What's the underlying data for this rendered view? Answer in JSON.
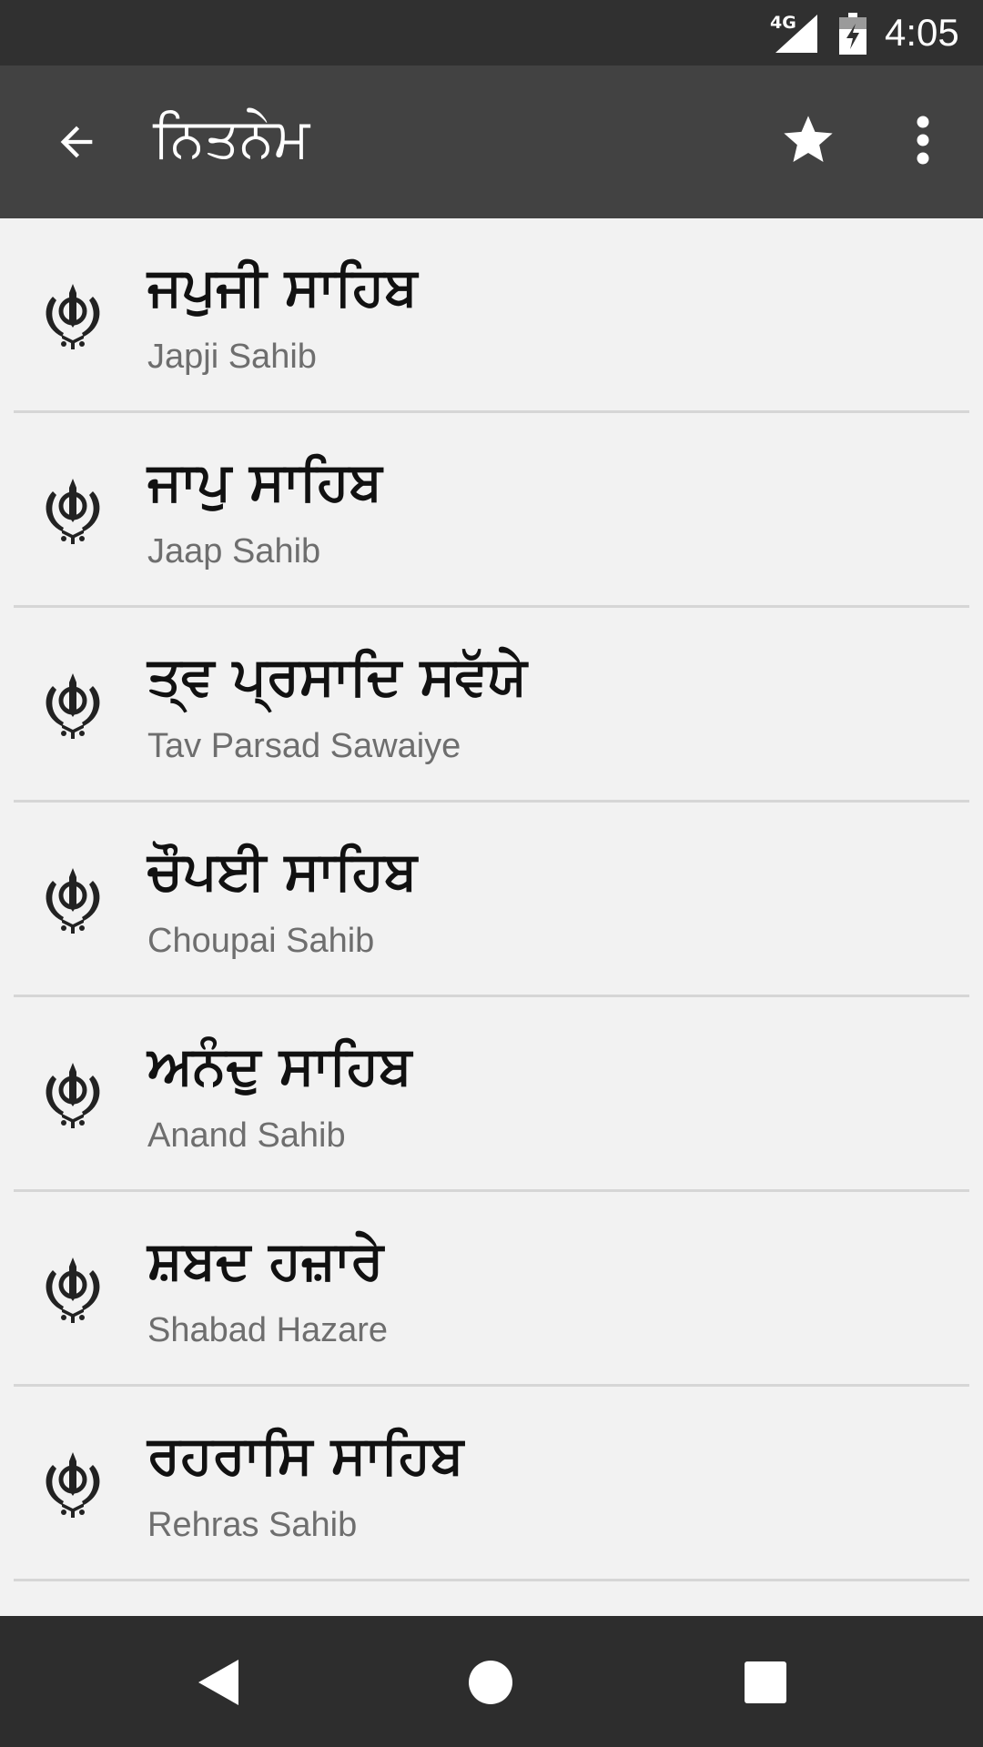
{
  "status_bar": {
    "network": "4G",
    "time": "4:05",
    "icons": [
      "signal-icon",
      "battery-charging-icon"
    ]
  },
  "app_bar": {
    "title": "ਨਿਤਨੇਮ",
    "icons": [
      "arrow-back-icon",
      "star-icon",
      "more-vert-icon"
    ]
  },
  "list": {
    "item_icon": "khanda-icon",
    "items": [
      {
        "title": "ਜਪੁਜੀ ਸਾਹਿਬ",
        "subtitle": "Japji Sahib"
      },
      {
        "title": "ਜਾਪੁ ਸਾਹਿਬ",
        "subtitle": "Jaap Sahib"
      },
      {
        "title": "ਤ੍ਵ ਪ੍ਰਸਾਦਿ ਸਵੱਯੇ",
        "subtitle": "Tav Parsad Sawaiye"
      },
      {
        "title": "ਚੌਪਈ ਸਾਹਿਬ",
        "subtitle": "Choupai Sahib"
      },
      {
        "title": "ਅਨੰਦੁ ਸਾਹਿਬ",
        "subtitle": "Anand Sahib"
      },
      {
        "title": "ਸ਼ਬਦ ਹਜ਼ਾਰੇ",
        "subtitle": "Shabad Hazare"
      },
      {
        "title": "ਰਹਰਾਸਿ ਸਾਹਿਬ",
        "subtitle": "Rehras Sahib"
      }
    ]
  },
  "nav_bar": {
    "icons": [
      "nav-back-icon",
      "nav-home-icon",
      "nav-recents-icon"
    ]
  },
  "colors": {
    "status_bar": "#303030",
    "app_bar": "#424242",
    "background": "#f2f2f2",
    "nav_bar": "#2d2d2d",
    "title_text": "#111111",
    "subtitle_text": "#6e6e6e"
  }
}
